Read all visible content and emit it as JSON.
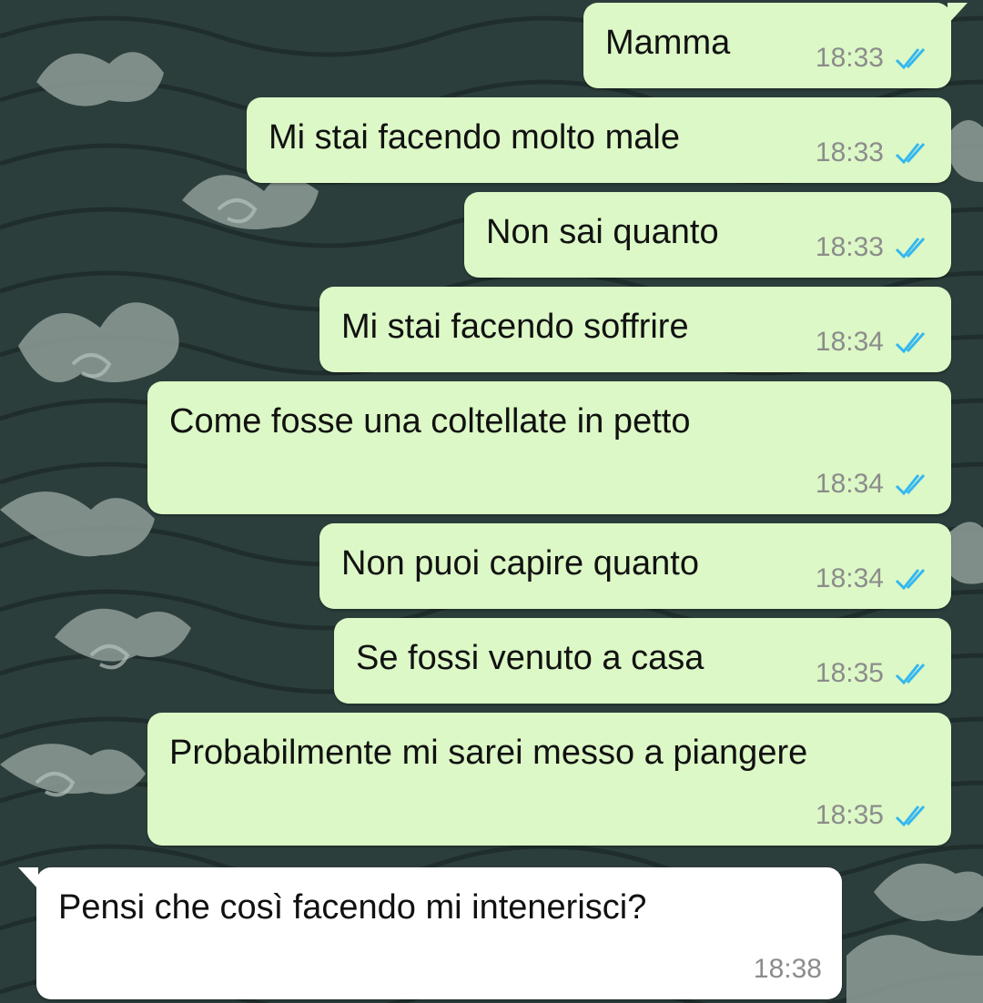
{
  "colors": {
    "outgoing_bubble": "#dcf8c6",
    "incoming_bubble": "#ffffff",
    "read_receipt": "#34b7f1",
    "timestamp": "#8c8c8c",
    "wallpaper_dark": "#2c3e3b",
    "wallpaper_light": "#8f9c98"
  },
  "messages": [
    {
      "direction": "outgoing",
      "text": "Mamma",
      "time": "18:33",
      "status_icon": "double-check-read-icon"
    },
    {
      "direction": "outgoing",
      "text": "Mi stai facendo molto male",
      "time": "18:33",
      "status_icon": "double-check-read-icon"
    },
    {
      "direction": "outgoing",
      "text": "Non sai quanto",
      "time": "18:33",
      "status_icon": "double-check-read-icon"
    },
    {
      "direction": "outgoing",
      "text": "Mi stai facendo soffrire",
      "time": "18:34",
      "status_icon": "double-check-read-icon"
    },
    {
      "direction": "outgoing",
      "text": "Come fosse una coltellate in petto",
      "time": "18:34",
      "status_icon": "double-check-read-icon"
    },
    {
      "direction": "outgoing",
      "text": "Non puoi capire quanto",
      "time": "18:34",
      "status_icon": "double-check-read-icon"
    },
    {
      "direction": "outgoing",
      "text": "Se fossi venuto a casa",
      "time": "18:35",
      "status_icon": "double-check-read-icon"
    },
    {
      "direction": "outgoing",
      "text": "Probabilmente mi sarei messo a piangere",
      "time": "18:35",
      "status_icon": "double-check-read-icon"
    },
    {
      "direction": "incoming",
      "text": "Pensi che così facendo mi intenerisci?",
      "time": "18:38"
    }
  ]
}
